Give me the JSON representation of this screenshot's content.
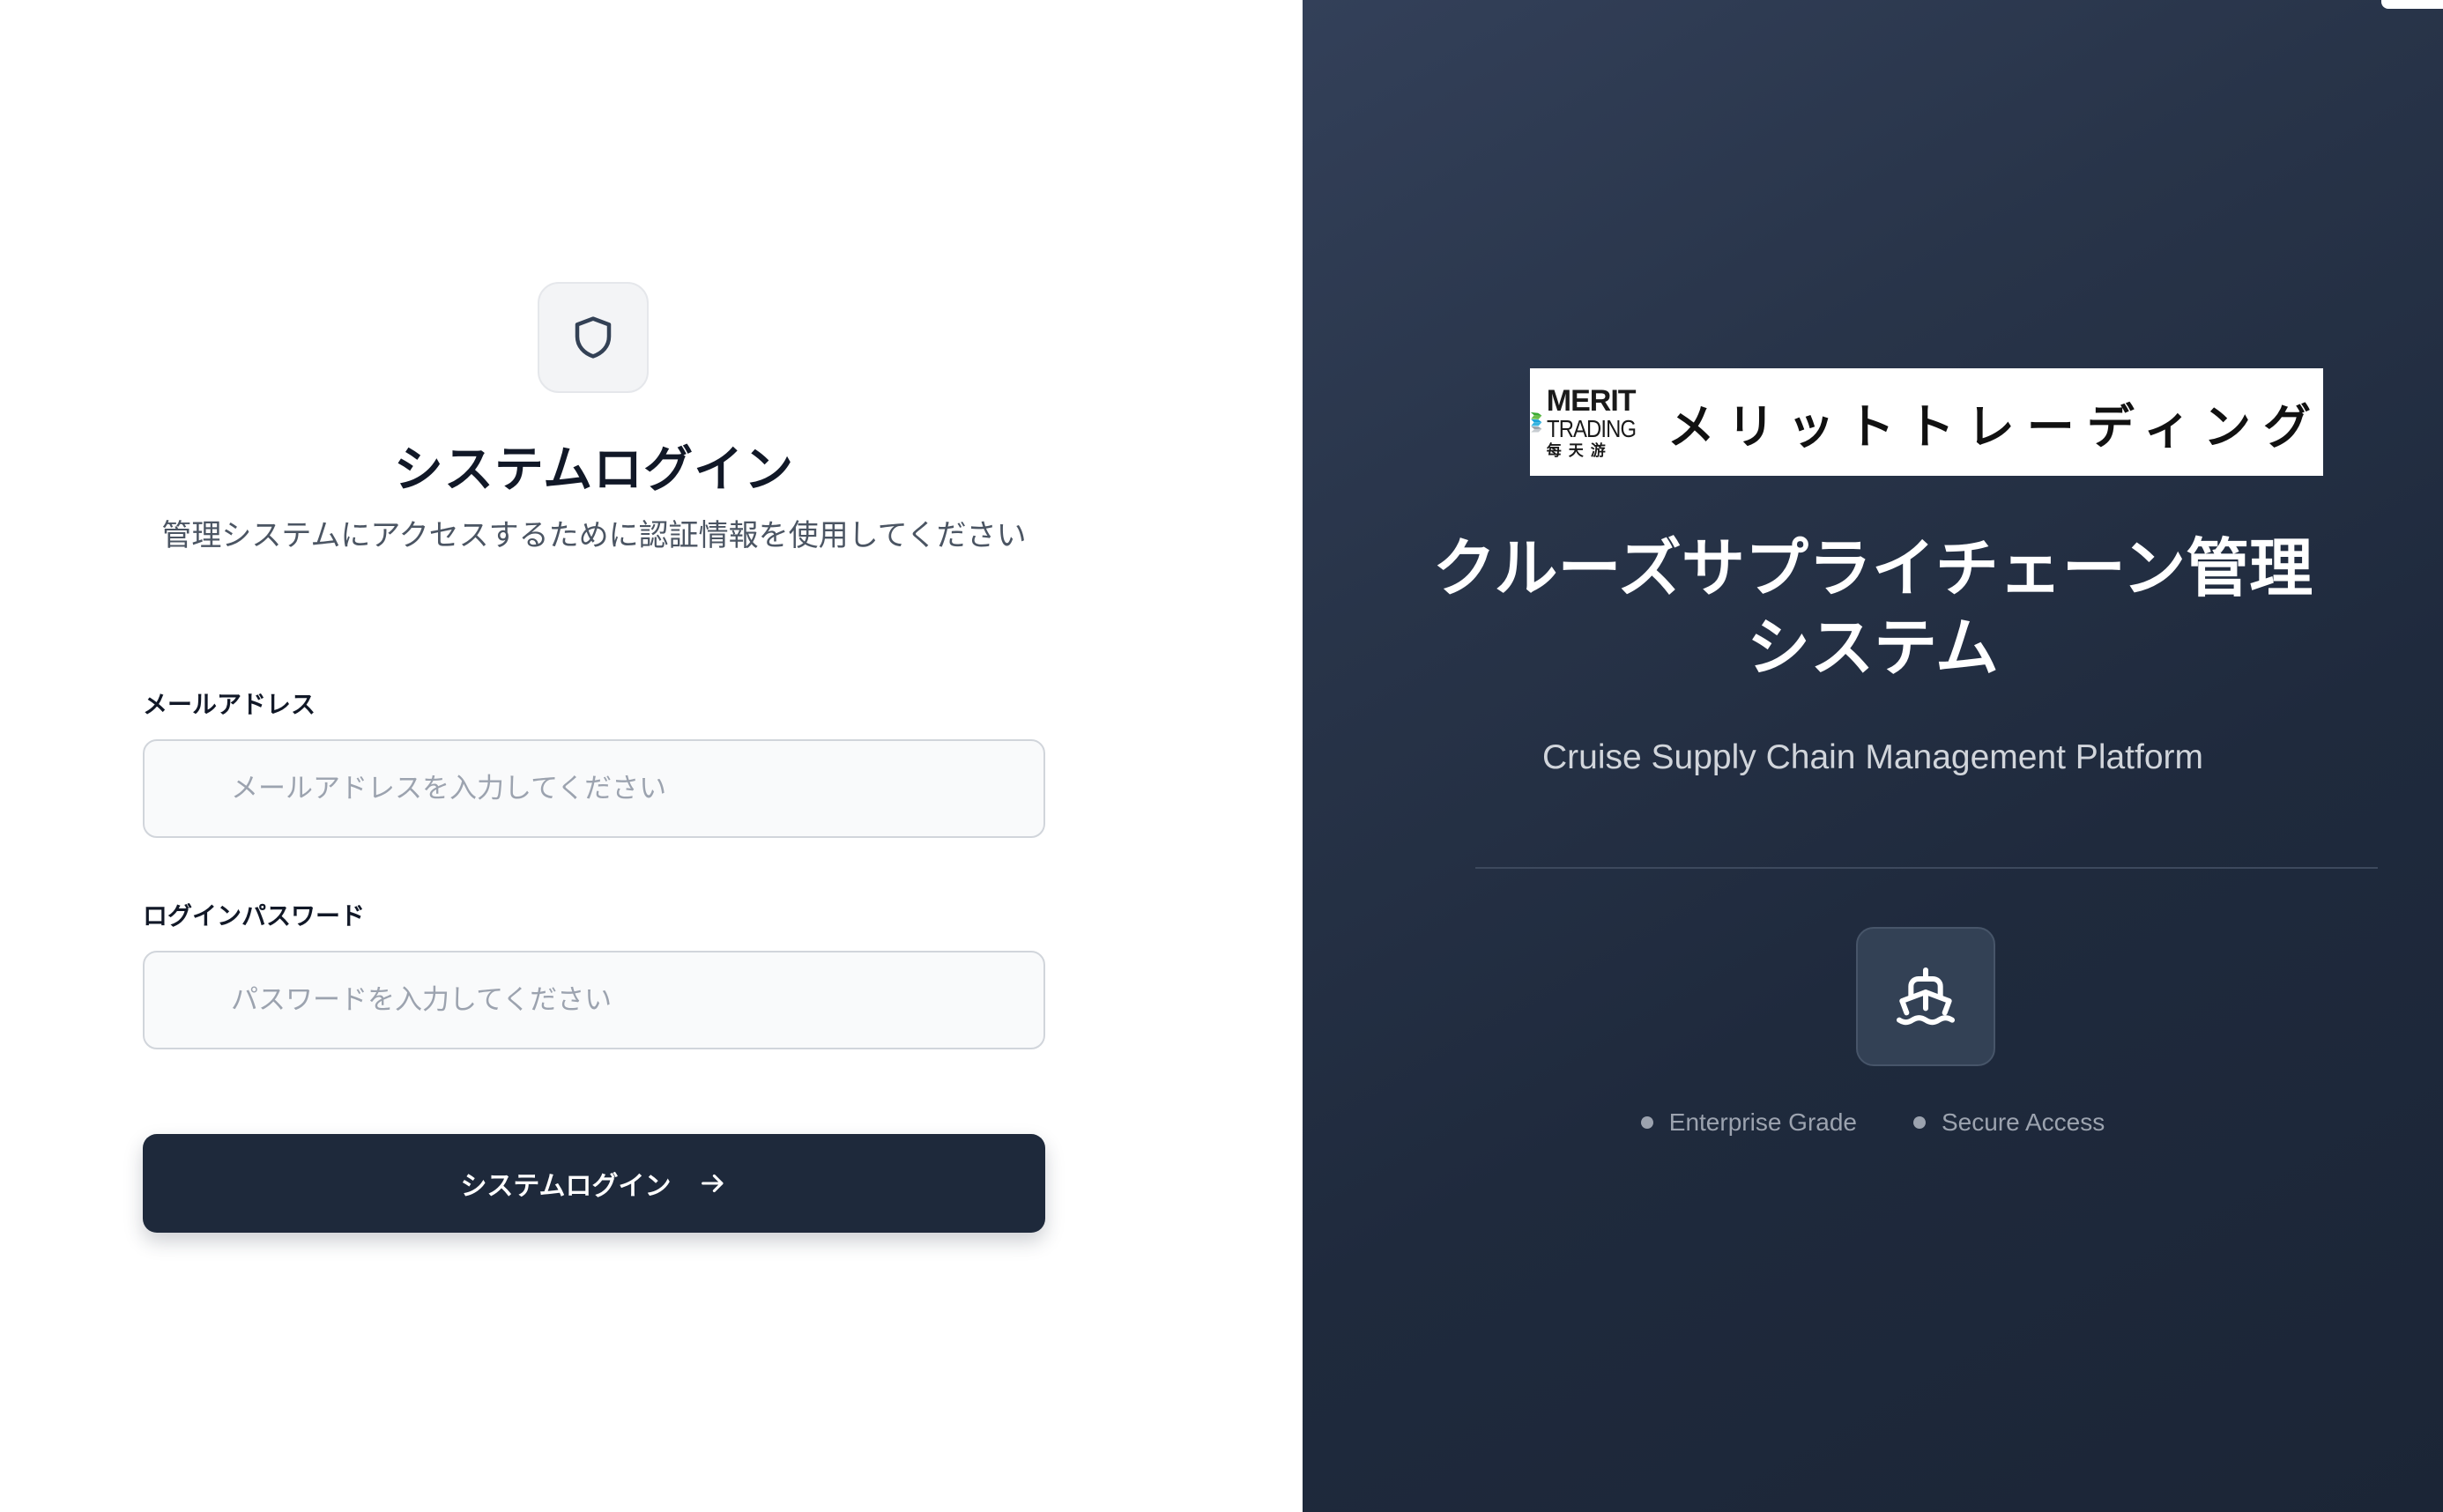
{
  "login": {
    "title": "システムログイン",
    "subtitle": "管理システムにアクセスするために認証情報を使用してください",
    "email_label": "メールアドレス",
    "email_placeholder": "メールアドレスを入力してください",
    "email_value": "",
    "password_label": "ログインパスワード",
    "password_placeholder": "パスワードを入力してください",
    "password_value": "",
    "submit_label": "システムログイン",
    "icons": {
      "header": "shield-icon",
      "submit": "arrow-right-icon"
    }
  },
  "brand": {
    "logo_merit": "MERIT",
    "logo_trading": "TRADING",
    "logo_cjk": "每天游",
    "logo_jp": "メリットトレーディング",
    "title": "クルーズサプライチェーン管理システム",
    "subtitle": "Cruise Supply Chain Management Platform",
    "badges": [
      "Enterprise Grade",
      "Secure Access"
    ],
    "icon": "ship-icon"
  },
  "colors": {
    "primary_button": "#1e293b",
    "panel_gradient_start": "#334059",
    "panel_gradient_end": "#1b2536",
    "logo_green": "#3aaa35",
    "logo_blue": "#1aa3d9"
  }
}
